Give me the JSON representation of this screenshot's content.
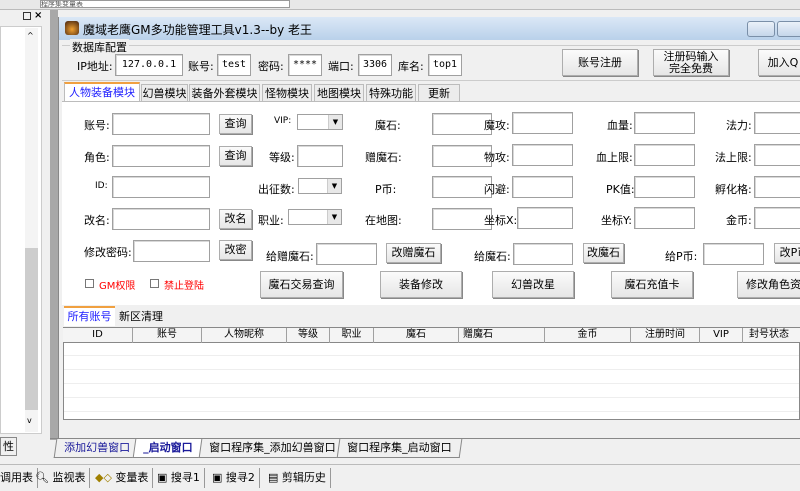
{
  "ide": {
    "top_field": "程序集变量表",
    "left_tab": "性",
    "bottom_tabs": [
      "添加幻兽窗口",
      "_启动窗口",
      "窗口程序集_添加幻兽窗口",
      "窗口程序集_启动窗口"
    ],
    "toolbar": [
      "调用表",
      "监视表",
      "变量表",
      "搜寻1",
      "搜寻2",
      "剪辑历史"
    ]
  },
  "window": {
    "title": "魔域老鹰GM多功能管理工具v1.3--by 老王"
  },
  "db": {
    "group": "数据库配置",
    "ip_label": "IP地址:",
    "ip": "127.0.0.1",
    "user_label": "账号:",
    "user": "test",
    "pwd_label": "密码:",
    "pwd": "****",
    "port_label": "端口:",
    "port": "3306",
    "dbname_label": "库名:",
    "dbname": "top1",
    "register": "账号注册",
    "regcode": "注册码输入\n完全免费",
    "joinq": "加入Q"
  },
  "tabs": [
    "人物装备模块",
    "幻兽模块",
    "装备外套模块",
    "怪物模块",
    "地图模块",
    "特殊功能",
    "更新"
  ],
  "form": {
    "account": "账号:",
    "role": "角色:",
    "id": "ID:",
    "rename": "改名:",
    "changepwd": "修改密码:",
    "query": "查询",
    "rename_btn": "改名",
    "changepwd_btn": "改密",
    "vip": "VIP:",
    "level": "等级:",
    "expedition": "出征数:",
    "job": "职业:",
    "magicstone": "魔石:",
    "giftstone": "赠魔石:",
    "pcoin": "P币:",
    "onmap": "在地图:",
    "matk": "魔攻:",
    "patk": "物攻:",
    "dodge": "闪避:",
    "x": "坐标X:",
    "hp": "血量:",
    "hpmax": "血上限:",
    "pk": "PK值:",
    "y": "坐标Y:",
    "mp": "法力:",
    "mpmax": "法上限:",
    "hatch": "孵化格:",
    "gold": "金币:",
    "give_gift": "给赠魔石:",
    "chg_gift": "改赠魔石",
    "give_stone": "给魔石:",
    "chg_stone": "改魔石",
    "give_p": "给P币:",
    "chg_p": "改P币",
    "gm": "GM权限",
    "ban": "禁止登陆",
    "actions": [
      "魔石交易查询",
      "装备修改",
      "幻兽改星",
      "魔石充值卡",
      "修改角色资"
    ]
  },
  "subtabs": [
    "所有账号",
    "新区清理"
  ],
  "table": {
    "columns": [
      "ID",
      "账号",
      "人物昵称",
      "等级",
      "职业",
      "魔石",
      "赠魔石",
      "金币",
      "注册时间",
      "VIP",
      "封号状态"
    ]
  }
}
